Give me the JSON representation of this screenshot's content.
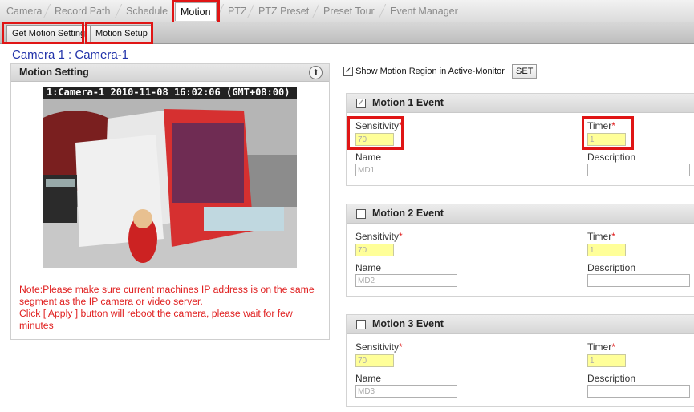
{
  "tabs": [
    "Camera",
    "Record Path",
    "Schedule",
    "Motion",
    "PTZ",
    "PTZ Preset",
    "Preset Tour",
    "Event Manager"
  ],
  "active_tab": "Motion",
  "subtabs": [
    "Get Motion Setting",
    "Motion Setup"
  ],
  "camera_title": "Camera 1 : Camera-1",
  "left_panel": {
    "title": "Motion Setting",
    "osd_text": "1:Camera-1   2010-11-08 16:02:06 (GMT+08:00)",
    "note": "Note:Please make sure current machines IP address is on the same segment as the IP camera or video server.",
    "note2": "Click [ Apply ] button will reboot the camera, please wait for few minutes"
  },
  "show_region": {
    "label": "Show Motion Region in Active-Monitor",
    "checked": true,
    "set_label": "SET"
  },
  "events": [
    {
      "title": "Motion 1 Event",
      "checked": true,
      "sensitivity_label": "Sensitivity",
      "sensitivity": "70",
      "timer_label": "Timer",
      "timer": "1",
      "name_label": "Name",
      "name": "MD1",
      "description_label": "Description",
      "description": ""
    },
    {
      "title": "Motion 2 Event",
      "checked": false,
      "sensitivity_label": "Sensitivity",
      "sensitivity": "70",
      "timer_label": "Timer",
      "timer": "1",
      "name_label": "Name",
      "name": "MD2",
      "description_label": "Description",
      "description": ""
    },
    {
      "title": "Motion 3 Event",
      "checked": false,
      "sensitivity_label": "Sensitivity",
      "sensitivity": "70",
      "timer_label": "Timer",
      "timer": "1",
      "name_label": "Name",
      "name": "MD3",
      "description_label": "Description",
      "description": ""
    }
  ],
  "colors": {
    "highlight": "#e01515",
    "required": "#e02020",
    "title_blue": "#2233aa",
    "input_yellow": "#ffff99"
  }
}
